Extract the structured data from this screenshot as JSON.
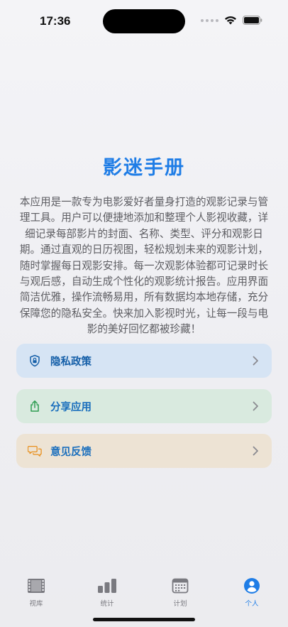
{
  "status_bar": {
    "time": "17:36"
  },
  "app": {
    "title": "影迷手册",
    "description": "本应用是一款专为电影爱好者量身打造的观影记录与管理工具。用户可以便捷地添加和整理个人影视收藏，详细记录每部影片的封面、名称、类型、评分和观影日期。通过直观的日历视图，轻松规划未来的观影计划，随时掌握每日观影安排。每一次观影体验都可记录时长与观后感，自动生成个性化的观影统计报告。应用界面简洁优雅，操作流畅易用，所有数据均本地存储，充分保障您的隐私安全。快来加入影视时光，让每一段与电影的美好回忆都被珍藏！"
  },
  "menu": [
    {
      "label": "隐私政策",
      "icon": "shield-lock-icon",
      "color": "#155fa8",
      "background": "#d6e4f4"
    },
    {
      "label": "分享应用",
      "icon": "share-icon",
      "color": "#1b6fbd",
      "background": "#d9eadf"
    },
    {
      "label": "意见反馈",
      "icon": "chat-bubbles-icon",
      "color": "#1b6fbd",
      "background": "#ede3d4"
    }
  ],
  "tabs": [
    {
      "label": "视库",
      "icon": "film-icon",
      "active": false
    },
    {
      "label": "统计",
      "icon": "bar-chart-icon",
      "active": false
    },
    {
      "label": "计划",
      "icon": "calendar-icon",
      "active": false
    },
    {
      "label": "个人",
      "icon": "person-circle-icon",
      "active": true
    }
  ],
  "colors": {
    "accent": "#1f7de6",
    "tab_inactive": "#7a7a80"
  }
}
